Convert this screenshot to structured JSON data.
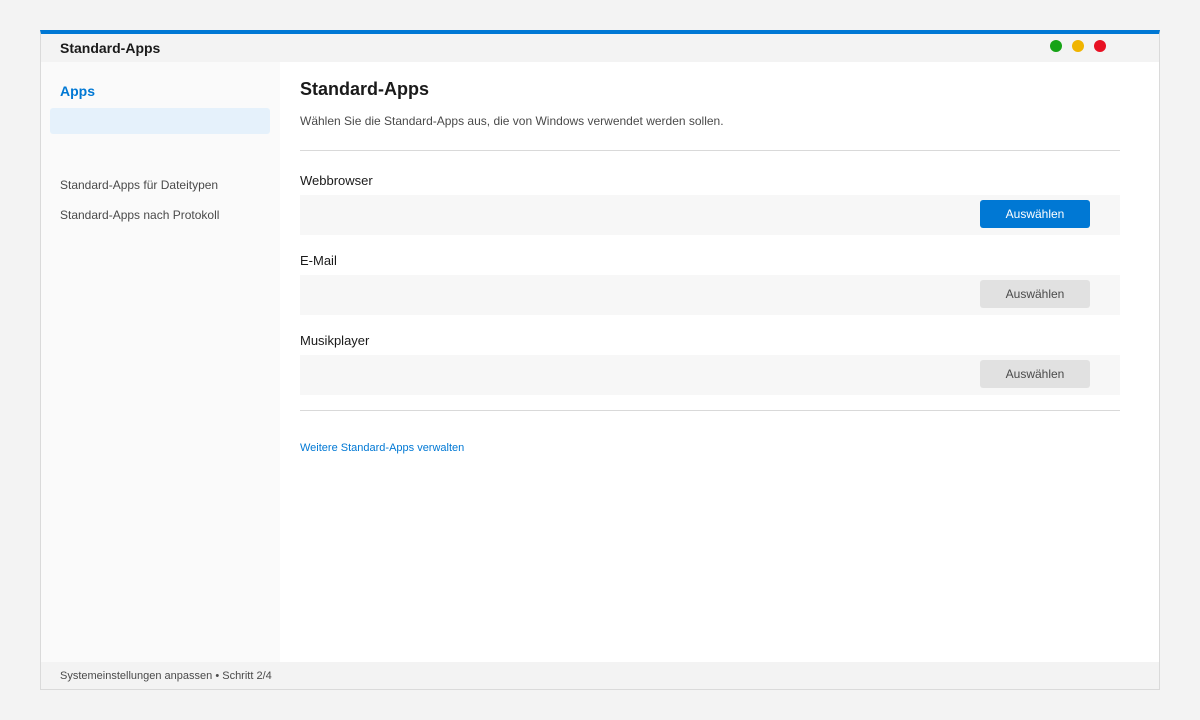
{
  "window": {
    "title": "Standard-Apps",
    "controls": [
      {
        "name": "green-window-button",
        "color": "#16a316"
      },
      {
        "name": "yellow-window-button",
        "color": "#f0b400"
      },
      {
        "name": "red-window-button",
        "color": "#e81123"
      }
    ]
  },
  "sidebar": {
    "heading": "Apps",
    "selected_item_label": "",
    "items": [
      {
        "label": "Standard-Apps für Dateitypen"
      },
      {
        "label": "Standard-Apps nach Protokoll"
      }
    ]
  },
  "main": {
    "title": "Standard-Apps",
    "description": "Wählen Sie die Standard-Apps aus, die von Windows verwendet werden sollen.",
    "sections": [
      {
        "label": "Webbrowser",
        "button_label": "Auswählen",
        "primary": true
      },
      {
        "label": "E-Mail",
        "button_label": "Auswählen",
        "primary": false
      },
      {
        "label": "Musikplayer",
        "button_label": "Auswählen",
        "primary": false
      }
    ],
    "more_link": "Weitere Standard-Apps verwalten"
  },
  "statusbar": {
    "text": "Systemeinstellungen anpassen • Schritt 2/4"
  },
  "colors": {
    "accent": "#0078d4",
    "selected_bg": "#e5f1fb"
  }
}
